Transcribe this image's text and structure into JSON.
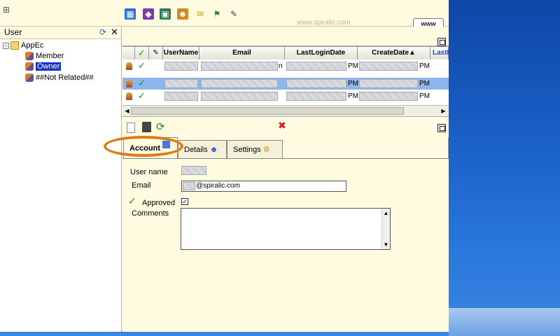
{
  "toolbar": {
    "site_url": "www.spiralic.com",
    "www_button": "www"
  },
  "left_panel": {
    "title": "User",
    "tree": {
      "root": "AppEc",
      "children": [
        {
          "label": "Member",
          "selected": false
        },
        {
          "label": "Owner",
          "selected": true
        },
        {
          "label": "##Not Related##",
          "selected": false
        }
      ]
    }
  },
  "grid": {
    "columns": [
      "UserName",
      "Email",
      "LastLoginDate",
      "CreateDate▲",
      "LastL"
    ],
    "rows": [
      {
        "email_suffix": "n",
        "last_login_suffix": "PM",
        "create_suffix": "PM",
        "selected": false
      },
      {
        "email_suffix": "",
        "last_login_suffix": "PM",
        "create_suffix": "PM",
        "selected": true
      },
      {
        "email_suffix": "",
        "last_login_suffix": "PM",
        "create_suffix": "PM",
        "selected": false
      }
    ]
  },
  "tabs": [
    {
      "label": "Account",
      "active": true
    },
    {
      "label": "Details",
      "active": false
    },
    {
      "label": "Settings",
      "active": false
    }
  ],
  "form": {
    "username_label": "User name",
    "email_label": "Email",
    "email_value": "@spiralic.com",
    "approved_label": "Approved",
    "approved_checked": "✓",
    "comments_label": "Comments"
  },
  "colors": {
    "accent_highlight": "#e07a12",
    "selection": "#1030d0",
    "row_selection": "#8cb6ec"
  }
}
